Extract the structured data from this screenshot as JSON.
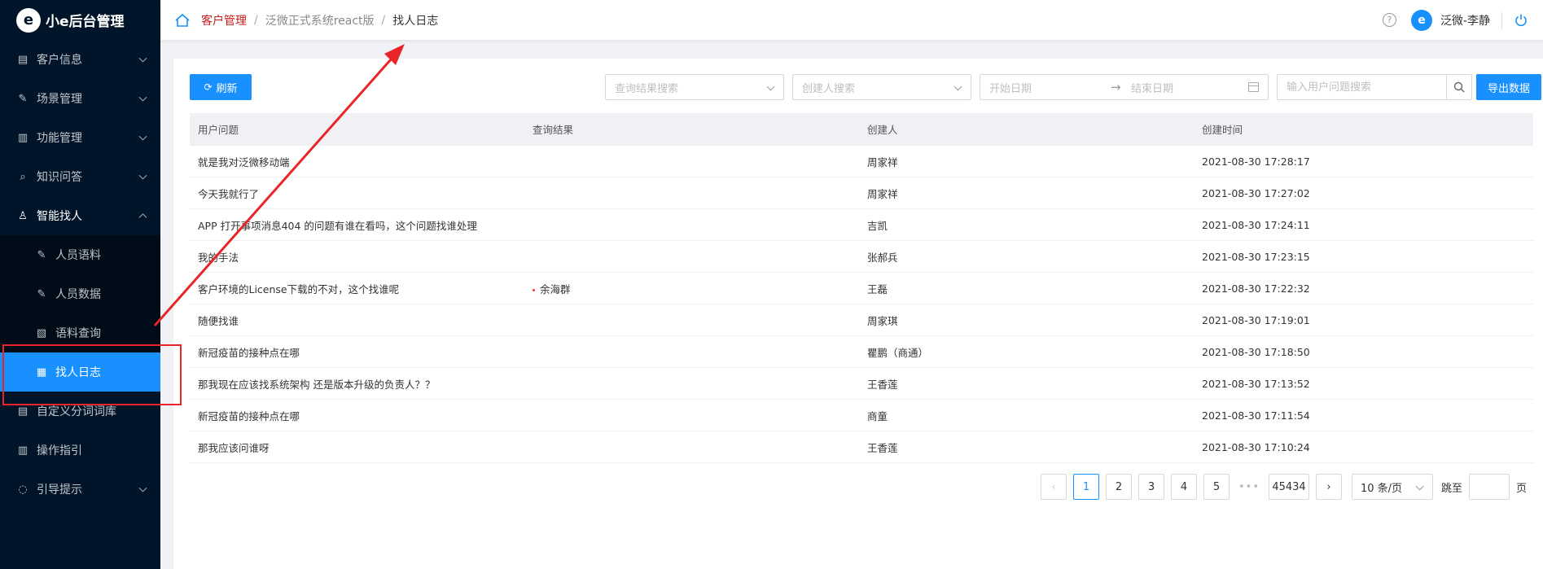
{
  "app": {
    "logo_glyph": "e",
    "title": "小e后台管理"
  },
  "sidebar": {
    "items": [
      {
        "label": "客户信息",
        "icon": "document-icon",
        "glyph": "▤",
        "has_arrow": true
      },
      {
        "label": "场景管理",
        "icon": "edit-icon",
        "glyph": "✎",
        "has_arrow": true
      },
      {
        "label": "功能管理",
        "icon": "layout-icon",
        "glyph": "▥",
        "has_arrow": true
      },
      {
        "label": "知识问答",
        "icon": "search-icon",
        "glyph": "⌕",
        "has_arrow": true
      },
      {
        "label": "智能找人",
        "icon": "user-icon",
        "glyph": "♙",
        "has_arrow": true,
        "open": true,
        "children": [
          {
            "label": "人员语料",
            "icon": "edit-icon",
            "glyph": "✎"
          },
          {
            "label": "人员数据",
            "icon": "edit-icon",
            "glyph": "✎"
          },
          {
            "label": "语料查询",
            "icon": "query-icon",
            "glyph": "▧"
          },
          {
            "label": "找人日志",
            "icon": "log-icon",
            "glyph": "▦",
            "active": true
          }
        ]
      },
      {
        "label": "自定义分词词库",
        "icon": "book-icon",
        "glyph": "▤",
        "has_arrow": false
      },
      {
        "label": "操作指引",
        "icon": "guide-icon",
        "glyph": "▥",
        "has_arrow": false
      },
      {
        "label": "引导提示",
        "icon": "bulb-icon",
        "glyph": "◌",
        "has_arrow": true
      }
    ]
  },
  "header": {
    "breadcrumb": [
      "客户管理",
      "泛微正式系统react版",
      "找人日志"
    ],
    "help_glyph": "?",
    "avatar_glyph": "e",
    "username": "泛微-李静"
  },
  "toolbar": {
    "refresh_glyph": "⟳",
    "refresh_label": "刷新",
    "result_search_placeholder": "查询结果搜索",
    "creator_search_placeholder": "创建人搜索",
    "start_date_placeholder": "开始日期",
    "date_separator": "→",
    "end_date_placeholder": "结束日期",
    "question_search_placeholder": "输入用户问题搜索",
    "export_label": "导出数据"
  },
  "table": {
    "columns": [
      "用户问题",
      "查询结果",
      "创建人",
      "创建时间"
    ],
    "rows": [
      {
        "question": "就是我对泛微移动端",
        "result": "",
        "creator": "周家祥",
        "time": "2021-08-30 17:28:17"
      },
      {
        "question": "今天我就行了",
        "result": "",
        "creator": "周家祥",
        "time": "2021-08-30 17:27:02"
      },
      {
        "question": "APP 打开事项消息404 的问题有谁在看吗，这个问题找谁处理",
        "result": "",
        "creator": "吉凯",
        "time": "2021-08-30 17:24:11"
      },
      {
        "question": "我的手法",
        "result": "",
        "creator": "张郝兵",
        "time": "2021-08-30 17:23:15"
      },
      {
        "question": "客户环境的License下载的不对，这个找谁呢",
        "result": "余海群",
        "creator": "王磊",
        "time": "2021-08-30 17:22:32"
      },
      {
        "question": "随便找谁",
        "result": "",
        "creator": "周家琪",
        "time": "2021-08-30 17:19:01"
      },
      {
        "question": "新冠疫苗的接种点在哪",
        "result": "",
        "creator": "瞿鹏（商通）",
        "time": "2021-08-30 17:18:50"
      },
      {
        "question": "那我现在应该找系统架构 还是版本升级的负责人？？",
        "result": "",
        "creator": "王香莲",
        "time": "2021-08-30 17:13:52"
      },
      {
        "question": "新冠疫苗的接种点在哪",
        "result": "",
        "creator": "商童",
        "time": "2021-08-30 17:11:54"
      },
      {
        "question": "那我应该问谁呀",
        "result": "",
        "creator": "王香莲",
        "time": "2021-08-30 17:10:24"
      }
    ]
  },
  "pagination": {
    "prev_glyph": "‹",
    "pages": [
      "1",
      "2",
      "3",
      "4",
      "5"
    ],
    "current": "1",
    "ellipsis": "•••",
    "last_page": "45434",
    "next_glyph": "›",
    "page_size": "10 条/页",
    "jump_label": "跳至",
    "page_suffix": "页"
  },
  "colors": {
    "sidebar_bg": "#001529",
    "primary": "#1890ff",
    "annotation": "#e8262a",
    "breadcrumb_active": "#c41d1d"
  }
}
